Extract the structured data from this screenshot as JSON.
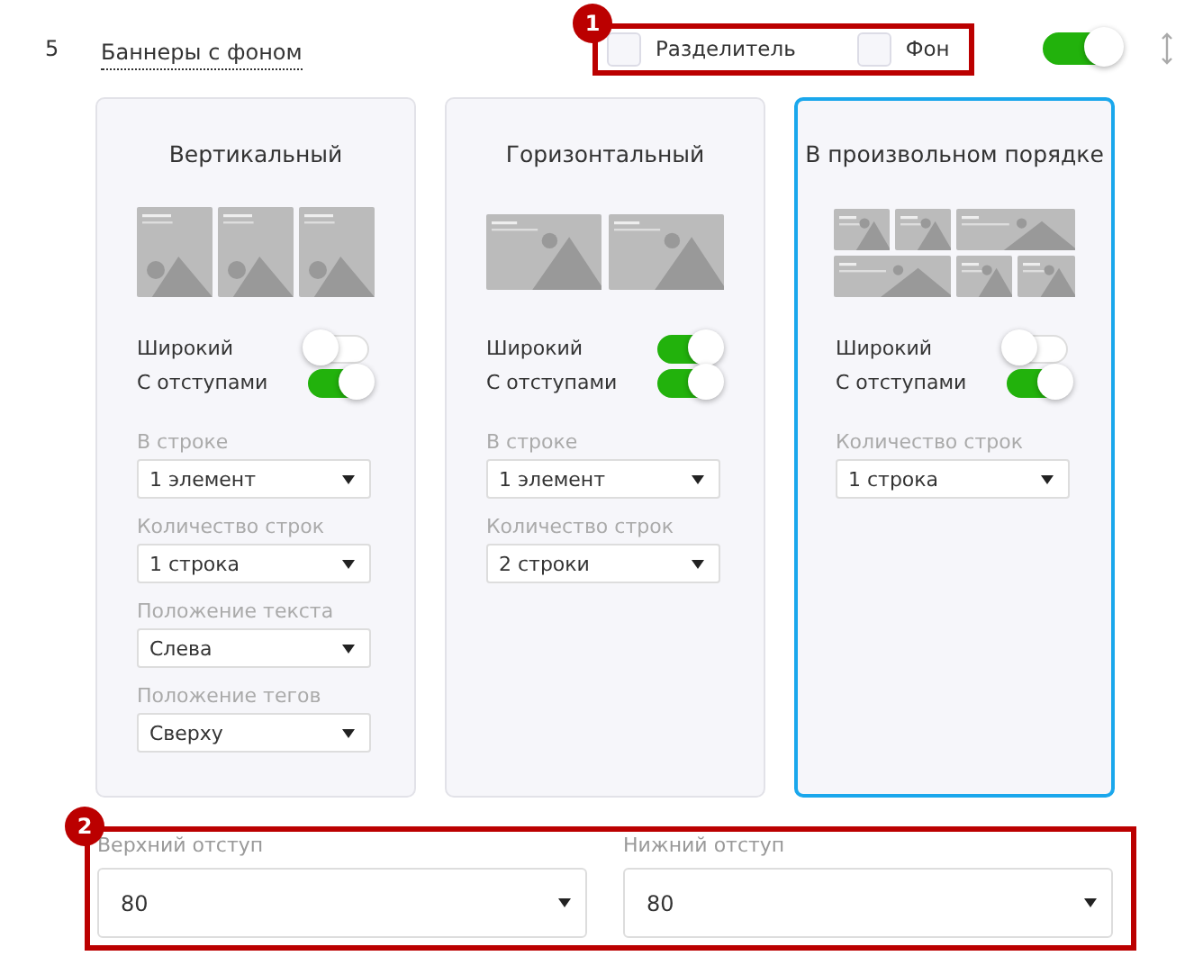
{
  "section": {
    "number": "5",
    "title": "Баннеры с фоном",
    "enabled": true,
    "options": [
      {
        "label": "Разделитель",
        "checked": false
      },
      {
        "label": "Фон",
        "checked": false
      }
    ]
  },
  "cards": [
    {
      "title": "Вертикальный",
      "kind": "vertical",
      "selected": false,
      "toggles": [
        {
          "label": "Широкий",
          "on": false
        },
        {
          "label": "С отступами",
          "on": true
        }
      ],
      "selects": [
        {
          "label": "В строке",
          "value": "1 элемент"
        },
        {
          "label": "Количество строк",
          "value": "1 строка"
        },
        {
          "label": "Положение текста",
          "value": "Слева"
        },
        {
          "label": "Положение тегов",
          "value": "Сверху"
        }
      ]
    },
    {
      "title": "Горизонтальный",
      "kind": "horizontal",
      "selected": false,
      "toggles": [
        {
          "label": "Широкий",
          "on": true
        },
        {
          "label": "С отступами",
          "on": true
        }
      ],
      "selects": [
        {
          "label": "В строке",
          "value": "1 элемент"
        },
        {
          "label": "Количество строк",
          "value": "2 строки"
        }
      ]
    },
    {
      "title": "В произвольном порядке",
      "kind": "mosaic",
      "selected": true,
      "toggles": [
        {
          "label": "Широкий",
          "on": false
        },
        {
          "label": "С отступами",
          "on": true
        }
      ],
      "selects": [
        {
          "label": "Количество строк",
          "value": "1 строка"
        }
      ]
    }
  ],
  "spacing": [
    {
      "label": "Верхний отступ",
      "value": "80"
    },
    {
      "label": "Нижний отступ",
      "value": "80"
    }
  ],
  "markers": [
    "1",
    "2"
  ]
}
